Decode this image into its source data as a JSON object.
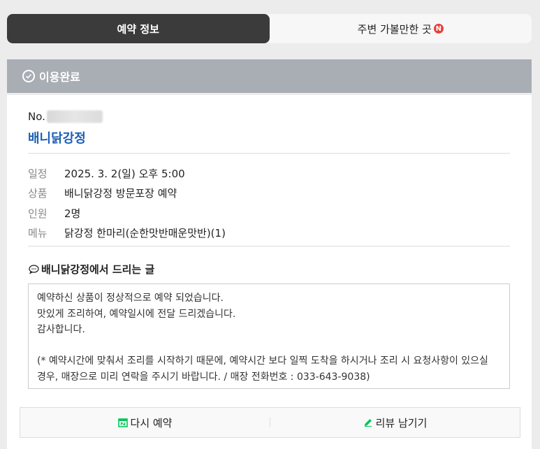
{
  "tabs": [
    {
      "label": "예약 정보",
      "active": true
    },
    {
      "label": "주변 가볼만한 곳",
      "badge": "N",
      "active": false
    }
  ],
  "status": {
    "label": "이용완료"
  },
  "reservation": {
    "no_prefix": "No.",
    "shop_name": "배니닭강정",
    "details": [
      {
        "label": "일정",
        "value": "2025. 3. 2(일) 오후 5:00"
      },
      {
        "label": "상품",
        "value": "배니닭강정 방문포장 예약"
      },
      {
        "label": "인원",
        "value": "2명"
      },
      {
        "label": "메뉴",
        "value": "닭강정 한마리(순한맛반매운맛반)(1)"
      }
    ]
  },
  "message": {
    "title": "배니닭강정에서 드리는 글",
    "lines": [
      "예약하신 상품이 정상적으로 예약 되었습니다.",
      "맛있게 조리하여, 예약일시에 전달 드리겠습니다.",
      "감사합니다.",
      "",
      "(* 예약시간에 맞춰서 조리를 시작하기 때문에, 예약시간 보다 일찍 도착을 하시거나 조리 시 요청사항이 있으실",
      "경우, 매장으로 미리 연락을 주시기 바랍니다. / 매장 전화번호 : 033-643-9038)"
    ]
  },
  "actions": {
    "rebook_label": "다시 예약",
    "review_label": "리뷰 남기기"
  },
  "colors": {
    "accent_blue": "#1a5fb4",
    "badge_red": "#e8413c",
    "icon_green": "#03c75a",
    "status_gray": "#a9adb4"
  }
}
